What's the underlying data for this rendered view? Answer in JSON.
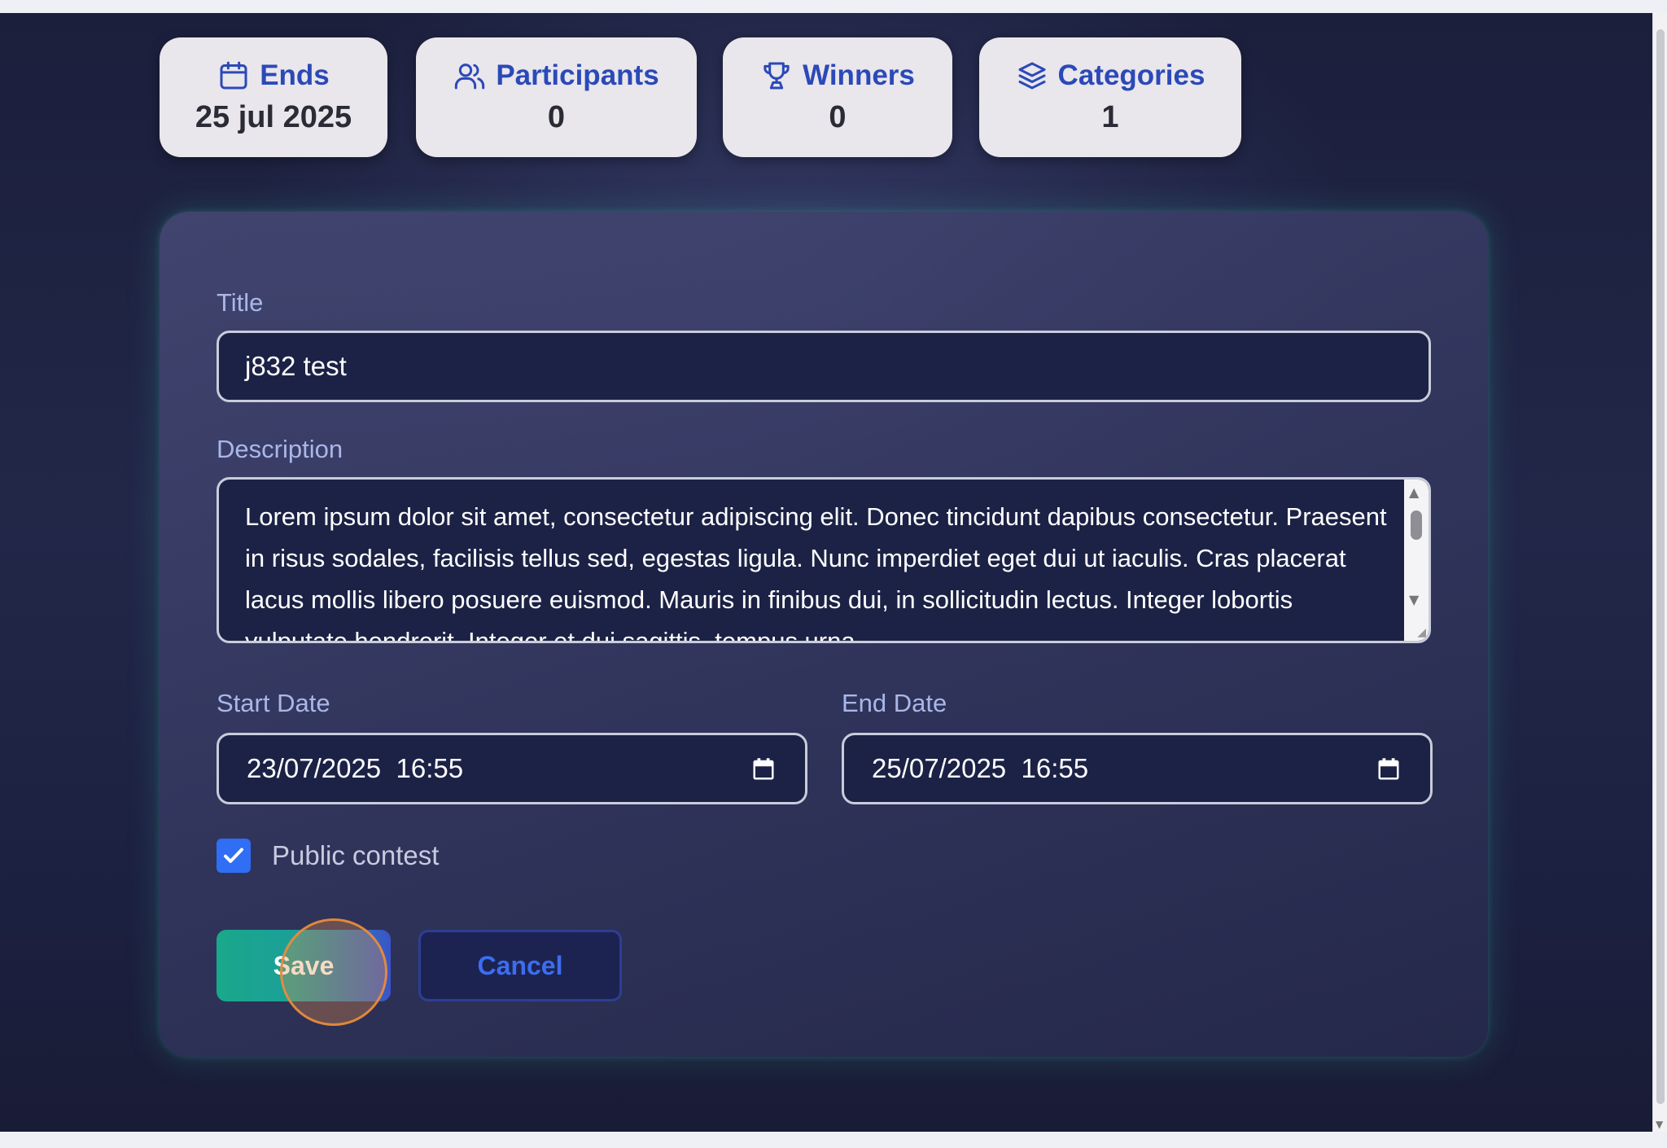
{
  "stats": [
    {
      "label": "Ends",
      "value": "25 jul 2025",
      "icon": "calendar-icon"
    },
    {
      "label": "Participants",
      "value": "0",
      "icon": "users-icon"
    },
    {
      "label": "Winners",
      "value": "0",
      "icon": "trophy-icon"
    },
    {
      "label": "Categories",
      "value": "1",
      "icon": "layers-icon"
    }
  ],
  "form": {
    "title_label": "Title",
    "title_value": "j832 test",
    "description_label": "Description",
    "description_value": "Lorem ipsum dolor sit amet, consectetur adipiscing elit. Donec tincidunt dapibus consectetur. Praesent in risus sodales, facilisis tellus sed, egestas ligula. Nunc imperdiet eget dui ut iaculis. Cras placerat lacus mollis libero posuere euismod. Mauris in finibus dui, in sollicitudin lectus. Integer lobortis vulputate hendrerit. Integer et dui sagittis, tempus urna",
    "start_date_label": "Start Date",
    "start_date_value": "23/07/2025  16:55",
    "end_date_label": "End Date",
    "end_date_value": "25/07/2025  16:55",
    "public_label": "Public contest",
    "public_checked": true,
    "save_label": "Save",
    "cancel_label": "Cancel"
  },
  "colors": {
    "accent_blue": "#2b49b8",
    "save_gradient_start": "#1aa88b",
    "save_gradient_end": "#3a55c9",
    "cancel_text": "#3c6df0",
    "checkbox": "#2f6ef5"
  }
}
